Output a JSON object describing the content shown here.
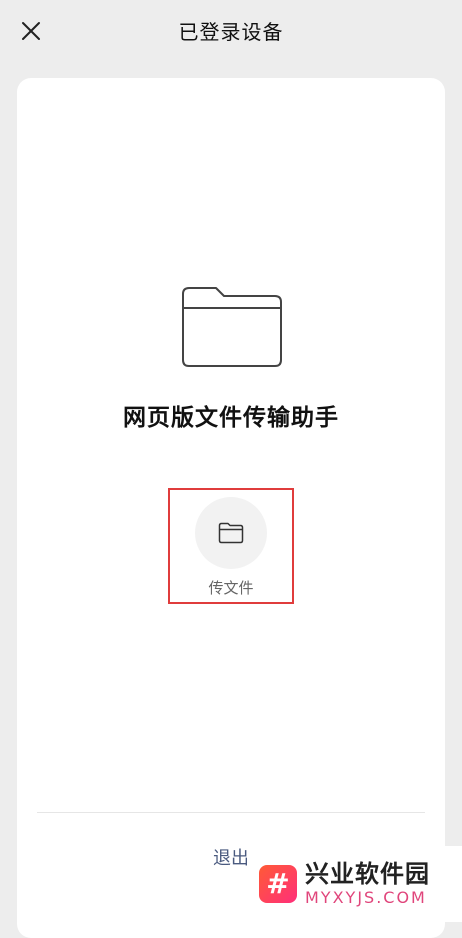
{
  "header": {
    "title": "已登录设备",
    "close_icon": "close-icon"
  },
  "device": {
    "name": "网页版文件传输助手",
    "icon": "folder-icon"
  },
  "actions": {
    "send_file_label": "传文件",
    "send_file_icon": "folder-icon"
  },
  "footer": {
    "logout_label": "退出"
  },
  "watermark": {
    "cn": "兴业软件园",
    "en": "MYXYJS.COM",
    "logo_glyph": "#"
  },
  "colors": {
    "background": "#ededed",
    "card": "#ffffff",
    "highlight": "#e03c3c",
    "logout": "#4a5a7f"
  }
}
